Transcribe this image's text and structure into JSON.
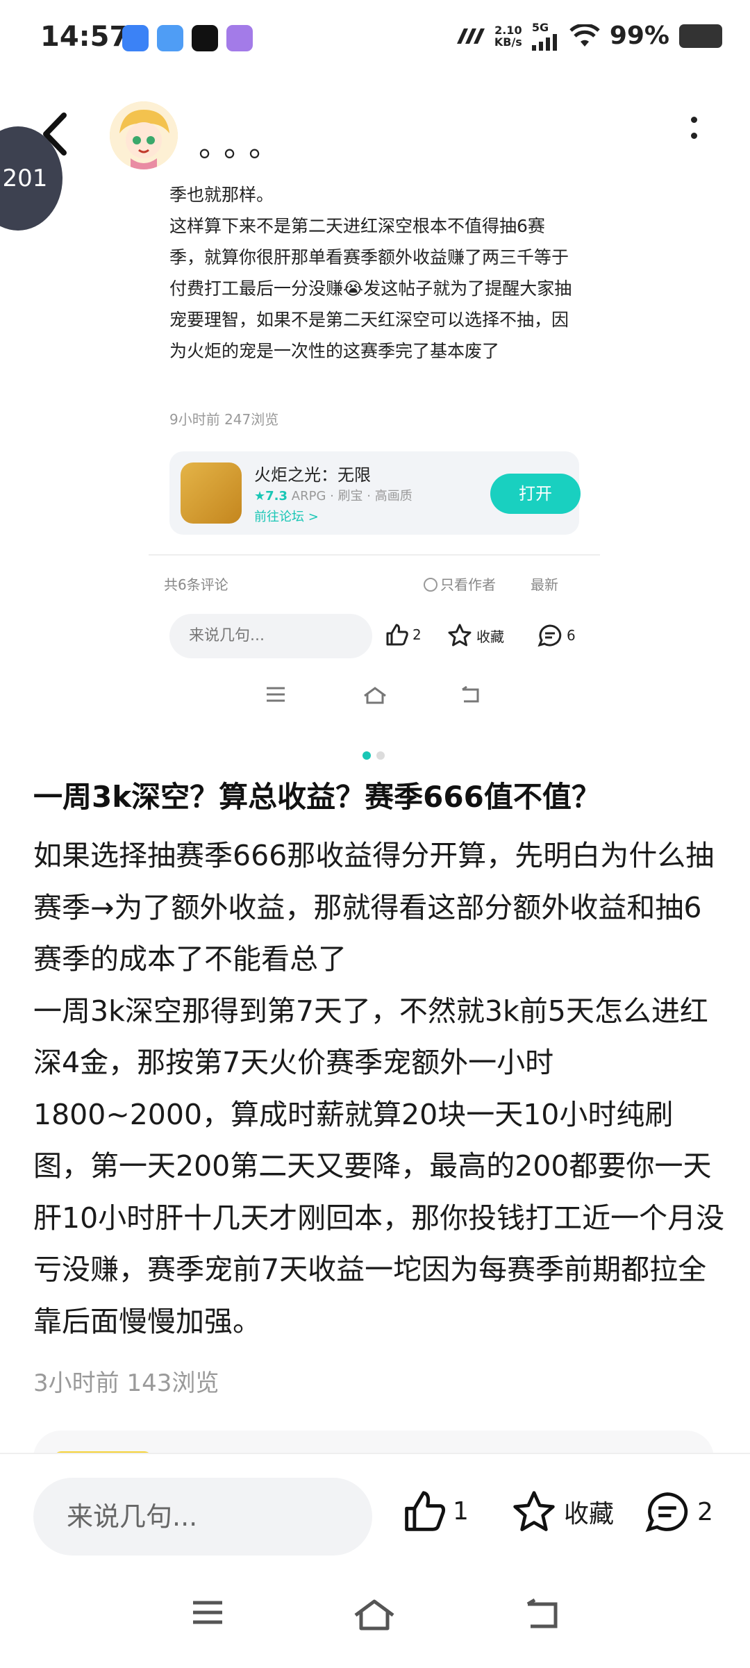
{
  "status_bar": {
    "time": "14:57",
    "net_speed_value": "2.10",
    "net_speed_unit": "KB/s",
    "network": "5G",
    "battery": "99%"
  },
  "header": {
    "author_name": "。。。",
    "image_counter": "201"
  },
  "embedded_screenshot": {
    "post_text": "季也就那样。\n这样算下来不是第二天进红深空根本不值得抽6赛季，就算你很肝那单看赛季额外收益赚了两三千等于付费打工最后一分没赚😭发这帖子就为了提醒大家抽宠要理智，如果不是第二天红深空可以选择不抽，因为火炬的宠是一次性的这赛季完了基本废了",
    "meta": "9小时前  247浏览",
    "game": {
      "name": "火炬之光：无限",
      "rating": "★7.3",
      "tags": "ARPG · 刷宝 · 高画质",
      "forum_link": "前往论坛 >",
      "open_button": "打开"
    },
    "comments_count": "共6条评论",
    "only_author": "只看作者",
    "newest": "最新",
    "comment_placeholder": "来说几句...",
    "likes": "2",
    "favorite": "收藏",
    "comments": "6"
  },
  "post": {
    "title": "一周3k深空？算总收益？赛季666值不值？",
    "body": "如果选择抽赛季666那收益得分开算，先明白为什么抽赛季→为了额外收益，那就得看这部分额外收益和抽6赛季的成本了不能看总了\n一周3k深空那得到第7天了，不然就3k前5天怎么进红深4金，那按第7天火价赛季宠额外一小时1800~2000，算成时薪就算20块一天10小时纯刷图，第一天200第二天又要降，最高的200都要你一天肝10小时肝十几天才刚回本，那你投钱打工近一个月没亏没赚，赛季宠前7天收益一坨因为每赛季前期都拉全靠后面慢慢加强。",
    "meta": "3小时前  143浏览"
  },
  "bottom_bar": {
    "comment_placeholder": "来说几句...",
    "likes": "1",
    "favorite": "收藏",
    "comments": "2"
  },
  "colors": {
    "accent": "#19c6b5",
    "counter_bg": "#3d4150"
  }
}
